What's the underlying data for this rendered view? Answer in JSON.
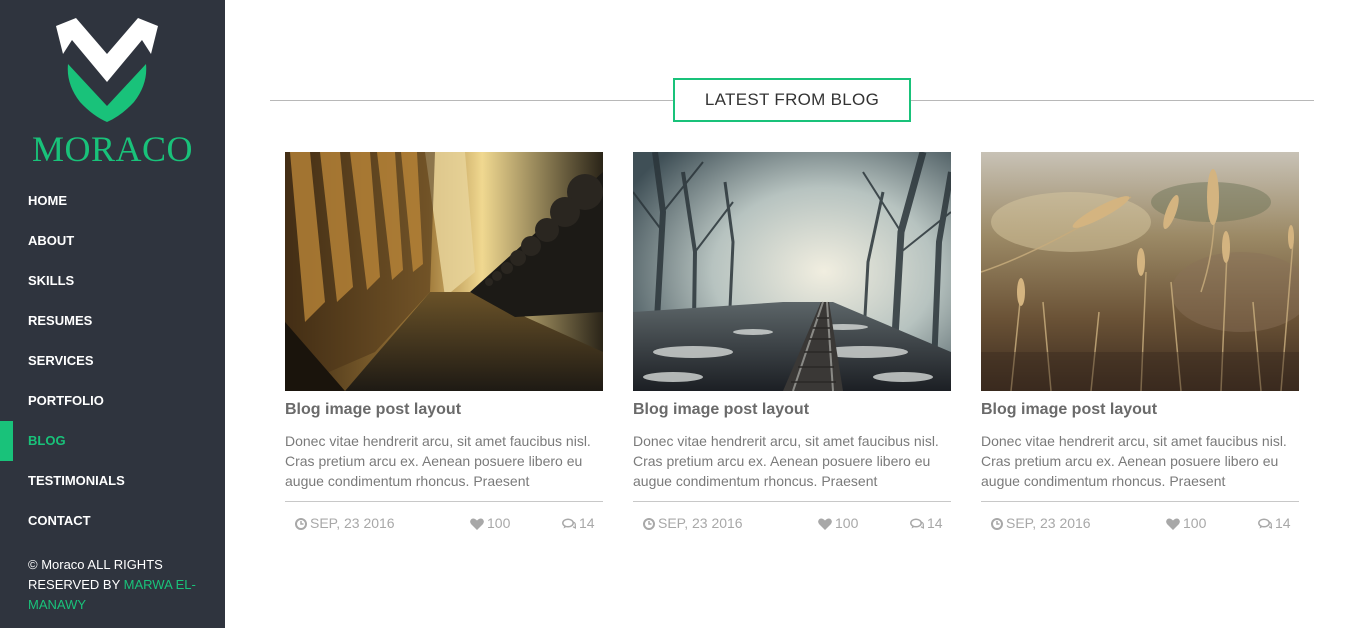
{
  "brand": {
    "name": "MORACO"
  },
  "nav": {
    "items": [
      {
        "label": "HOME"
      },
      {
        "label": "ABOUT"
      },
      {
        "label": "SKILLS"
      },
      {
        "label": "RESUMES"
      },
      {
        "label": "SERVICES"
      },
      {
        "label": "PORTFOLIO"
      },
      {
        "label": "BLOG",
        "active": true
      },
      {
        "label": "TESTIMONIALS"
      },
      {
        "label": "CONTACT"
      }
    ]
  },
  "footer": {
    "copyright": "© Moraco ALL RIGHTS RESERVED BY ",
    "author": "MARWA EL-MANAWY"
  },
  "section": {
    "title": "LATEST FROM BLOG"
  },
  "posts": [
    {
      "title": "Blog image post layout",
      "excerpt": "Donec vitae hendrerit arcu, sit amet faucibus nisl. Cras pretium arcu ex. Aenean posuere libero eu augue condimentum rhoncus. Praesent",
      "date": "SEP, 23 2016",
      "likes": "100",
      "comments": "14",
      "image": "library-benches-photo"
    },
    {
      "title": "Blog image post layout",
      "excerpt": "Donec vitae hendrerit arcu, sit amet faucibus nisl. Cras pretium arcu ex. Aenean posuere libero eu augue condimentum rhoncus. Praesent",
      "date": "SEP, 23 2016",
      "likes": "100",
      "comments": "14",
      "image": "foggy-forest-railway-photo"
    },
    {
      "title": "Blog image post layout",
      "excerpt": "Donec vitae hendrerit arcu, sit amet faucibus nisl. Cras pretium arcu ex. Aenean posuere libero eu augue condimentum rhoncus. Praesent",
      "date": "SEP, 23 2016",
      "likes": "100",
      "comments": "14",
      "image": "wheat-field-photo"
    }
  ],
  "colors": {
    "accent": "#19c27a",
    "sidebar": "#2f343e",
    "text": "#7a7a7a",
    "meta": "#a8a8a8"
  },
  "icons": {
    "date": "clock-icon",
    "likes": "heart-icon",
    "comments": "comments-icon"
  }
}
